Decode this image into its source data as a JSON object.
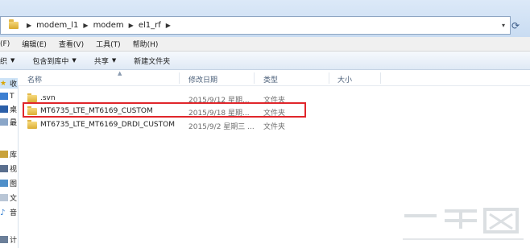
{
  "address": {
    "crumbs": [
      "modem_l1",
      "modem",
      "el1_rf"
    ],
    "dropdown_glyph": "▾",
    "refresh_icon": "refresh-icon"
  },
  "menu": {
    "items": [
      "(F)",
      "编辑(E)",
      "查看(V)",
      "工具(T)",
      "帮助(H)"
    ]
  },
  "toolbar": {
    "items": [
      {
        "label": "织",
        "caret": "▼"
      },
      {
        "label": "包含到库中",
        "caret": "▼"
      },
      {
        "label": "共享",
        "caret": "▼"
      },
      {
        "label": "新建文件夹",
        "caret": ""
      }
    ]
  },
  "sidebar": {
    "items": [
      "收",
      "T",
      "桌",
      "最",
      "库",
      "视",
      "图",
      "文",
      "音",
      "计"
    ]
  },
  "columns": {
    "name": "名称",
    "date": "修改日期",
    "type": "类型",
    "size": "大小"
  },
  "files": [
    {
      "name": ".svn",
      "date": "2015/9/12 星期...",
      "type": "文件夹"
    },
    {
      "name": "MT6735_LTE_MT6169_CUSTOM",
      "date": "2015/9/18 星期...",
      "type": "文件夹"
    },
    {
      "name": "MT6735_LTE_MT6169_DRDI_CUSTOM",
      "date": "2015/9/2 星期三 ...",
      "type": "文件夹"
    }
  ],
  "colors": {
    "highlight": "#e0262b",
    "folder": "#dcae33",
    "header_text": "#4c607a"
  }
}
